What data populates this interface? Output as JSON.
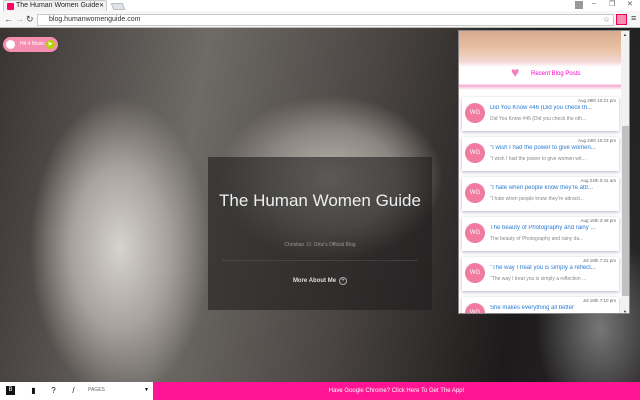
{
  "browser": {
    "tab_title": "The Human Women Guide",
    "url": "blog.humanwomenguide.com"
  },
  "music_widget": {
    "label": "Hit 4 Music"
  },
  "hero": {
    "title": "The Human Women Guide",
    "subtitle": "Christian .O. Ortiz's Official Blog",
    "more_label": "More About Me",
    "more_icon": "+"
  },
  "popup": {
    "heading": "Recent Blog Posts",
    "posts": [
      {
        "avatar": "WG",
        "date": "Aug 28th 10:21 pm",
        "title": "Did You Know #46 (Did you check th...",
        "excerpt": "Did You Know #46 (Did you check the oth..."
      },
      {
        "avatar": "WG",
        "date": "Aug 24th 10:23 pm",
        "title": "\"I wish I had the power to give women...",
        "excerpt": "\"I wish I had the power to give women wit..."
      },
      {
        "avatar": "WG",
        "date": "Aug 24th 0:41 am",
        "title": "\"I hate when people know they're attr...",
        "excerpt": "\"I hate when people know they're attracti..."
      },
      {
        "avatar": "WG",
        "date": "Aug 15th 3:48 pm",
        "title": "The beauty of Photography and rainy ...",
        "excerpt": "The beauty of Photography and rainy da..."
      },
      {
        "avatar": "WG",
        "date": "Jul 18th 7:31 pm",
        "title": "\"The way I treat you is simply a reflect...",
        "excerpt": "\"The way I treat you is simply a reflection ..."
      },
      {
        "avatar": "WG",
        "date": "Jul 18th 7:10 pm",
        "title": "She makes everything all better",
        "excerpt": ""
      }
    ]
  },
  "bottom": {
    "pages_label": "PAGES",
    "promo": "Have Google Chrome? Click Here To Get The App!"
  },
  "colors": {
    "accent": "#ff1493",
    "avatar": "#f07aa0",
    "link": "#2e7bd0"
  }
}
